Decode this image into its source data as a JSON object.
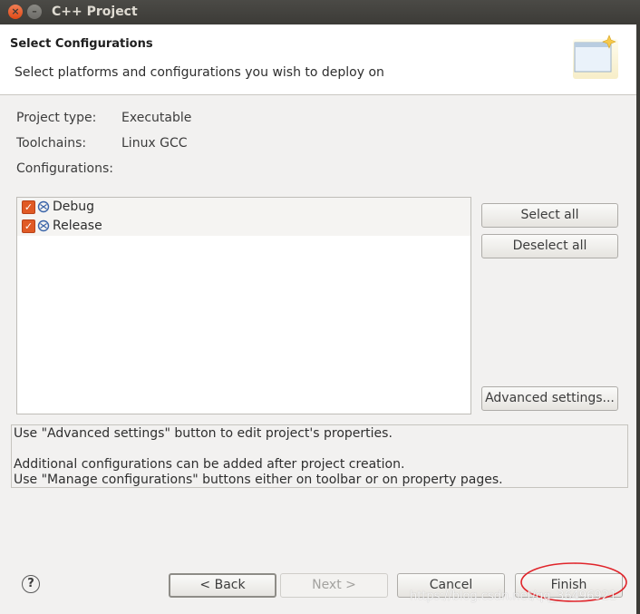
{
  "window": {
    "title": "C++ Project",
    "close_glyph": "×",
    "minimize_glyph": "–"
  },
  "header": {
    "title": "Select Configurations",
    "description": "Select platforms and configurations you wish to deploy on",
    "icon": "wizard-banner-icon"
  },
  "project": {
    "type_label": "Project type:",
    "type_value": "Executable",
    "toolchains_label": "Toolchains:",
    "toolchains_value": "Linux GCC",
    "configurations_label": "Configurations:"
  },
  "configurations": [
    {
      "label": "Debug",
      "checked": true
    },
    {
      "label": "Release",
      "checked": true
    }
  ],
  "side_buttons": {
    "select_all": "Select all",
    "deselect_all": "Deselect all",
    "advanced": "Advanced settings..."
  },
  "info": {
    "line1": "Use \"Advanced settings\" button to edit project's properties.",
    "line2": "Additional configurations can be added after project creation.",
    "line3": "Use \"Manage configurations\" buttons either on toolbar or on property pages."
  },
  "footer": {
    "help": "?",
    "back": "< Back",
    "next": "Next >",
    "cancel": "Cancel",
    "finish": "Finish"
  },
  "watermark": "https://blog.csdn.net/qq_36496921",
  "colors": {
    "checkbox": "#e05a25",
    "highlight_circle": "#e0242a",
    "titlebar": "#3c3b37"
  }
}
